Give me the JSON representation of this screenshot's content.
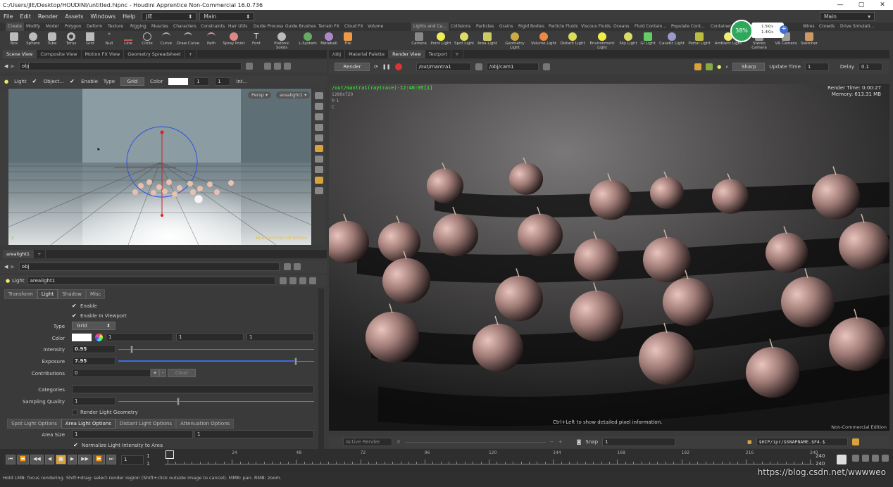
{
  "window": {
    "title": "C:/Users/JIE/Desktop/HOUDINI/untitled.hipnc - Houdini Apprentice Non-Commercial 16.0.736",
    "controls": [
      "—",
      "▢",
      "✕"
    ]
  },
  "menu": {
    "items": [
      "File",
      "Edit",
      "Render",
      "Assets",
      "Windows",
      "Help"
    ],
    "desktop_left": "JIE",
    "desktop_right": "Main",
    "desktop_far": "Main"
  },
  "shelf_tabs_left": [
    "Create",
    "Modify",
    "Model",
    "Polygon",
    "Deform",
    "Texture",
    "Rigging",
    "Muscles",
    "Characters",
    "Constraints",
    "Hair Utils",
    "Guide Process",
    "Guide Brushes",
    "Terrain FX",
    "Cloud FX",
    "Volume"
  ],
  "shelf_tabs_right": [
    "Lights and Ca...",
    "Collisions",
    "Particles",
    "Grains",
    "Rigid Bodies",
    "Particle Fluids",
    "Viscous Fluids",
    "Oceans",
    "Fluid Contain...",
    "Populate Cont...",
    "Container...",
    "Wires",
    "Crowds",
    "Drive Simulati..."
  ],
  "shelf_tools_left": [
    "Box",
    "Sphere",
    "Tube",
    "Torus",
    "Grid",
    "Null",
    "Line",
    "Circle",
    "Curve",
    "Draw Curve",
    "Path",
    "Spray Point",
    "Font",
    "Platonic Solids",
    "L-System",
    "Metaball",
    "File"
  ],
  "shelf_tools_right": [
    "Camera",
    "Point Light",
    "Spot Light",
    "Area Light",
    "Geometry Light",
    "Volume Light",
    "Distant Light",
    "Environment Light",
    "Sky Light",
    "GI Light",
    "Caustic Light",
    "Portal Light",
    "Ambient Light",
    "Stereo Camera",
    "VR Camera",
    "Switcher"
  ],
  "perf": {
    "percent": "38%",
    "up": "1.5K/s",
    "down": "1.4K/s"
  },
  "left_top_tabs": [
    "Scene View",
    "Composite View",
    "Motion FX View",
    "Geometry Spreadsheet"
  ],
  "scene_path": "obj",
  "light_bar": {
    "light": "Light",
    "object": "Object...",
    "enable": "Enable",
    "type_label": "Type",
    "type_value": "Grid",
    "color_label": "Color",
    "v1": "1",
    "v2": "1",
    "more": "Int..."
  },
  "viewport": {
    "persp": "Persp ▾",
    "camera": "arealight1 ▾",
    "watermark": "Non-Commercial Edition"
  },
  "param_tab": "arealight1",
  "param_path": "obj",
  "node": {
    "type": "Light",
    "name": "arealight1"
  },
  "param_tabs": [
    "Transform",
    "Light",
    "Shadow",
    "Misc"
  ],
  "params": {
    "enable": "Enable",
    "enable_viewport": "Enable In Viewport",
    "type_label": "Type",
    "type_value": "Grid",
    "color_label": "Color",
    "color_r": "1",
    "color_g": "1",
    "color_b": "1",
    "intensity_label": "Intensity",
    "intensity": "0.95",
    "exposure_label": "Exposure",
    "exposure": "7.95",
    "contrib_label": "Contributions",
    "contrib": "0",
    "clear": "Clear",
    "categories_label": "Categories",
    "sampling_label": "Sampling Quality",
    "sampling": "1",
    "render_geo": "Render Light Geometry",
    "area_size_label": "Area Size",
    "area_x": "1",
    "area_y": "1",
    "normalize": "Normalize Light Intensity to Area",
    "intensity_fraction": 0.06,
    "exposure_fraction": 0.9,
    "sampling_fraction": 0.3
  },
  "sub_tabs": [
    "Spot Light Options",
    "Area Light Options",
    "Distant Light Options",
    "Attenuation Options"
  ],
  "right_tabs": [
    "/obj",
    "Material Palette",
    "Render View",
    "Textport"
  ],
  "render_bar": {
    "render": "Render",
    "rop": "/out/mantra1",
    "cam": "/obj/cam1",
    "mode": "Sharp",
    "update_label": "Update Time",
    "update_value": "1",
    "delay_label": "Delay",
    "delay_value": "0.1"
  },
  "render_overlay": {
    "header": "/out/mantra1(raytrace)-12:46:05[1]",
    "res": "1280x720",
    "frame": "fr 1",
    "channel": "C",
    "time": "Render Time: 0:00:27",
    "memory": "Memory:   613.31 MB",
    "hint": "Ctrl+Left to show detailed pixel information.",
    "watermark": "Non-Commercial Edition"
  },
  "render_bottom": {
    "active": "Active Render",
    "snap": "Snap",
    "snap_value": "1",
    "path": "$HIP/ipr/$SNAPNAME.$F4.$"
  },
  "timeline": {
    "frame": "1",
    "start": "1",
    "start2": "1",
    "end": "240",
    "end2": "240",
    "ticks": [
      "1",
      "24",
      "48",
      "72",
      "96",
      "120",
      "144",
      "168",
      "192",
      "216",
      "240"
    ]
  },
  "status": "Hold LMB: focus rendering. Shift+drag: select render region (Shift+click outside image to cancel). MMB: pan. RMB: zoom.",
  "url_watermark": "https://blog.csdn.net/wwwweo"
}
